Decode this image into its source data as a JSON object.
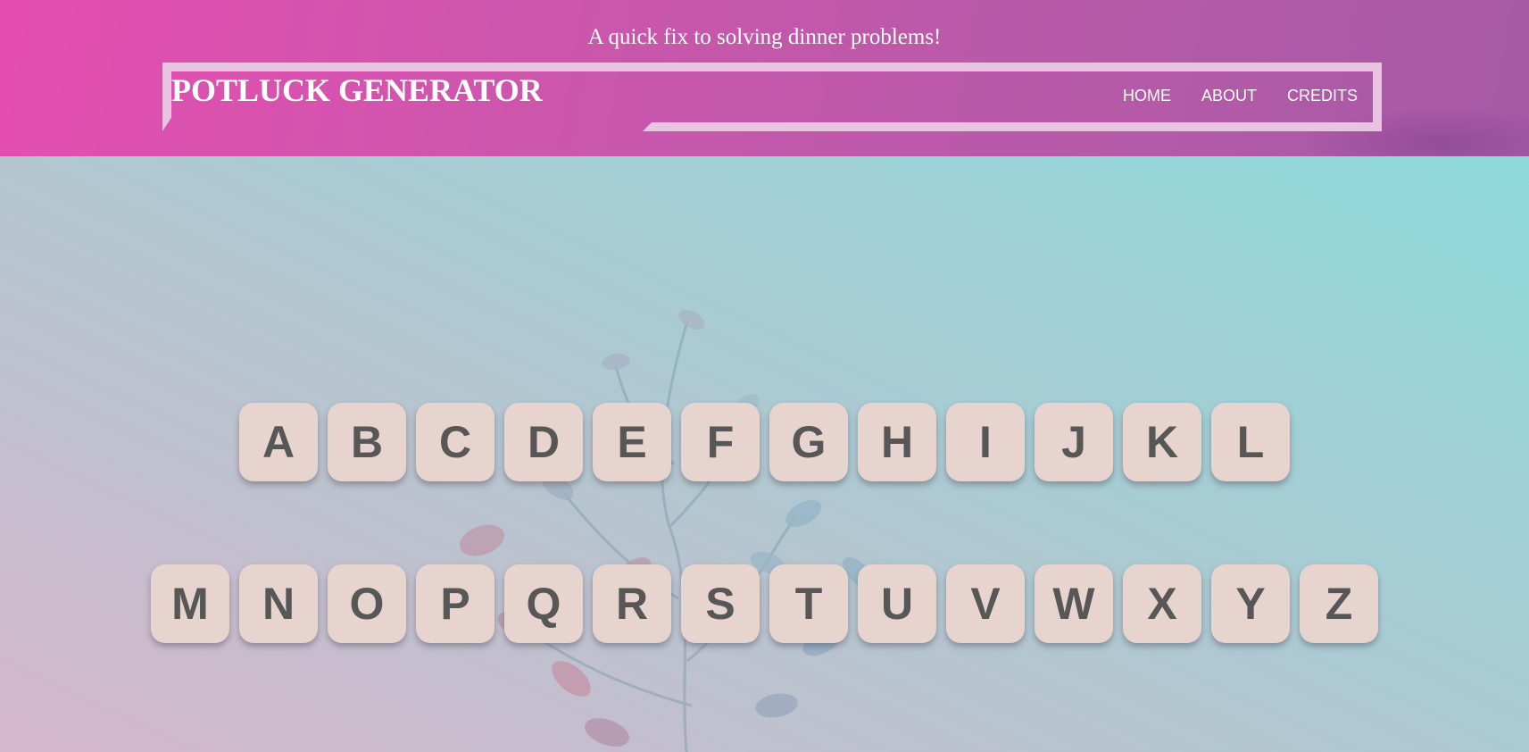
{
  "header": {
    "tagline": "A quick fix to solving dinner problems!",
    "logo": "POTLUCK GENERATOR",
    "nav": [
      {
        "label": "HOME"
      },
      {
        "label": "ABOUT"
      },
      {
        "label": "CREDITS"
      }
    ]
  },
  "letters": {
    "row1": [
      "A",
      "B",
      "C",
      "D",
      "E",
      "F",
      "G",
      "H",
      "I",
      "J",
      "K",
      "L"
    ],
    "row2": [
      "M",
      "N",
      "O",
      "P",
      "Q",
      "R",
      "S",
      "T",
      "U",
      "V",
      "W",
      "X",
      "Y",
      "Z"
    ]
  },
  "colors": {
    "header_pink": "#e44eb0",
    "header_purple": "#a55aa6",
    "frame": "#e8c3e2",
    "key_bg": "#e7d4cf",
    "key_text": "#575757",
    "bg_teal": "#86dcdc"
  },
  "background_image": "plant-leaves"
}
